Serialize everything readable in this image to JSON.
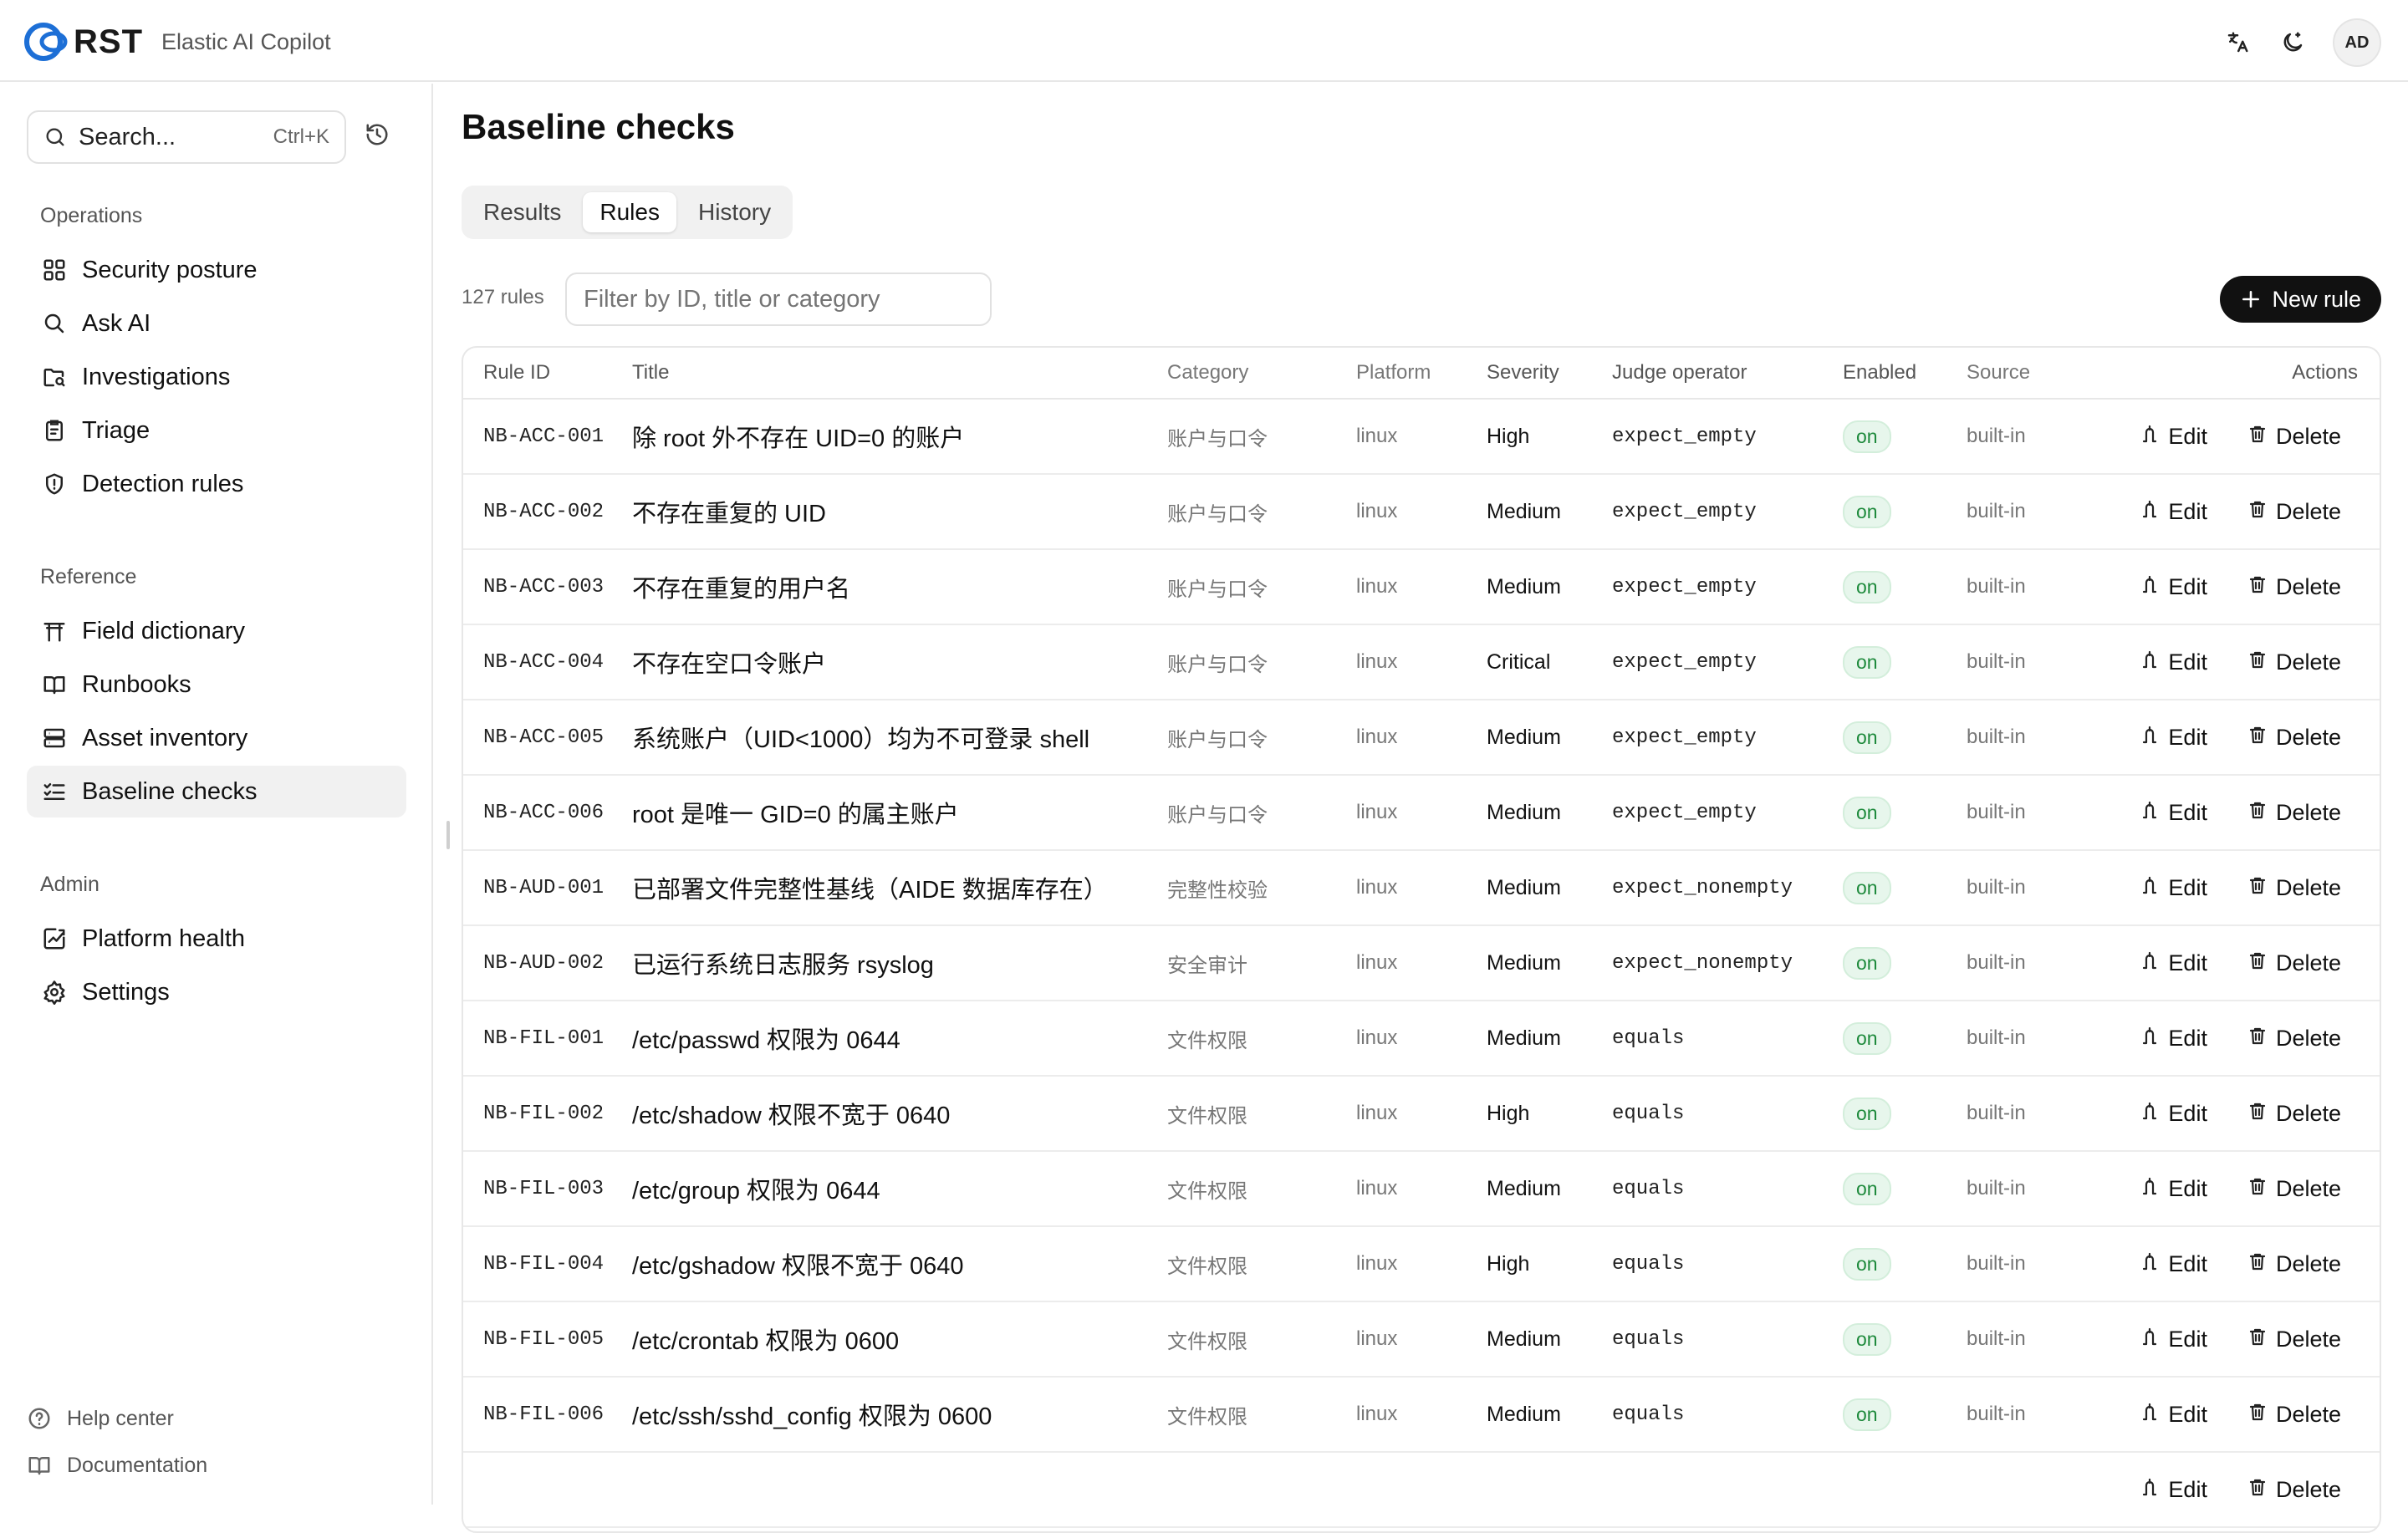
{
  "header": {
    "logo_text": "RST",
    "app_name": "Elastic AI Copilot",
    "avatar_initials": "AD",
    "icons": [
      "translate-icon",
      "theme-toggle-icon"
    ]
  },
  "sidebar": {
    "search": {
      "placeholder": "Search...",
      "shortcut": "Ctrl+K"
    },
    "sections": [
      {
        "label": "Operations",
        "items": [
          {
            "label": "Security posture",
            "icon": "grid-icon"
          },
          {
            "label": "Ask AI",
            "icon": "search-icon"
          },
          {
            "label": "Investigations",
            "icon": "folder-search-icon"
          },
          {
            "label": "Triage",
            "icon": "clipboard-icon"
          },
          {
            "label": "Detection rules",
            "icon": "shield-icon"
          }
        ]
      },
      {
        "label": "Reference",
        "items": [
          {
            "label": "Field dictionary",
            "icon": "torii-icon"
          },
          {
            "label": "Runbooks",
            "icon": "book-icon"
          },
          {
            "label": "Asset inventory",
            "icon": "server-icon"
          },
          {
            "label": "Baseline checks",
            "icon": "list-checks-icon",
            "active": true
          }
        ]
      },
      {
        "label": "Admin",
        "items": [
          {
            "label": "Platform health",
            "icon": "chart-icon"
          },
          {
            "label": "Settings",
            "icon": "gear-icon"
          }
        ]
      }
    ],
    "footer": [
      {
        "label": "Help center",
        "icon": "help-icon"
      },
      {
        "label": "Documentation",
        "icon": "book-icon"
      }
    ]
  },
  "main": {
    "title": "Baseline checks",
    "tabs": [
      {
        "label": "Results"
      },
      {
        "label": "Rules",
        "active": true
      },
      {
        "label": "History"
      }
    ],
    "rule_count": "127 rules",
    "filter_placeholder": "Filter by ID, title or category",
    "new_rule_label": "New rule",
    "table": {
      "columns": [
        "Rule ID",
        "Title",
        "Category",
        "Platform",
        "Severity",
        "Judge operator",
        "Enabled",
        "Source",
        "Actions"
      ],
      "edit_label": "Edit",
      "delete_label": "Delete",
      "rows": [
        {
          "id": "NB-ACC-001",
          "title": "除 root 外不存在 UID=0 的账户",
          "category": "账户与口令",
          "platform": "linux",
          "severity": "High",
          "operator": "expect_empty",
          "enabled": "on",
          "source": "built-in"
        },
        {
          "id": "NB-ACC-002",
          "title": "不存在重复的 UID",
          "category": "账户与口令",
          "platform": "linux",
          "severity": "Medium",
          "operator": "expect_empty",
          "enabled": "on",
          "source": "built-in"
        },
        {
          "id": "NB-ACC-003",
          "title": "不存在重复的用户名",
          "category": "账户与口令",
          "platform": "linux",
          "severity": "Medium",
          "operator": "expect_empty",
          "enabled": "on",
          "source": "built-in"
        },
        {
          "id": "NB-ACC-004",
          "title": "不存在空口令账户",
          "category": "账户与口令",
          "platform": "linux",
          "severity": "Critical",
          "operator": "expect_empty",
          "enabled": "on",
          "source": "built-in"
        },
        {
          "id": "NB-ACC-005",
          "title": "系统账户（UID<1000）均为不可登录 shell",
          "category": "账户与口令",
          "platform": "linux",
          "severity": "Medium",
          "operator": "expect_empty",
          "enabled": "on",
          "source": "built-in"
        },
        {
          "id": "NB-ACC-006",
          "title": "root 是唯一 GID=0 的属主账户",
          "category": "账户与口令",
          "platform": "linux",
          "severity": "Medium",
          "operator": "expect_empty",
          "enabled": "on",
          "source": "built-in"
        },
        {
          "id": "NB-AUD-001",
          "title": "已部署文件完整性基线（AIDE 数据库存在）",
          "category": "完整性校验",
          "platform": "linux",
          "severity": "Medium",
          "operator": "expect_nonempty",
          "enabled": "on",
          "source": "built-in"
        },
        {
          "id": "NB-AUD-002",
          "title": "已运行系统日志服务 rsyslog",
          "category": "安全审计",
          "platform": "linux",
          "severity": "Medium",
          "operator": "expect_nonempty",
          "enabled": "on",
          "source": "built-in"
        },
        {
          "id": "NB-FIL-001",
          "title": "/etc/passwd 权限为 0644",
          "category": "文件权限",
          "platform": "linux",
          "severity": "Medium",
          "operator": "equals",
          "enabled": "on",
          "source": "built-in"
        },
        {
          "id": "NB-FIL-002",
          "title": "/etc/shadow 权限不宽于 0640",
          "category": "文件权限",
          "platform": "linux",
          "severity": "High",
          "operator": "equals",
          "enabled": "on",
          "source": "built-in"
        },
        {
          "id": "NB-FIL-003",
          "title": "/etc/group 权限为 0644",
          "category": "文件权限",
          "platform": "linux",
          "severity": "Medium",
          "operator": "equals",
          "enabled": "on",
          "source": "built-in"
        },
        {
          "id": "NB-FIL-004",
          "title": "/etc/gshadow 权限不宽于 0640",
          "category": "文件权限",
          "platform": "linux",
          "severity": "High",
          "operator": "equals",
          "enabled": "on",
          "source": "built-in"
        },
        {
          "id": "NB-FIL-005",
          "title": "/etc/crontab 权限为 0600",
          "category": "文件权限",
          "platform": "linux",
          "severity": "Medium",
          "operator": "equals",
          "enabled": "on",
          "source": "built-in"
        },
        {
          "id": "NB-FIL-006",
          "title": "/etc/ssh/sshd_config 权限为 0600",
          "category": "文件权限",
          "platform": "linux",
          "severity": "Medium",
          "operator": "equals",
          "enabled": "on",
          "source": "built-in"
        },
        {
          "id": "",
          "title": "",
          "category": "",
          "platform": "",
          "severity": "",
          "operator": "",
          "enabled": "",
          "source": ""
        }
      ]
    }
  }
}
